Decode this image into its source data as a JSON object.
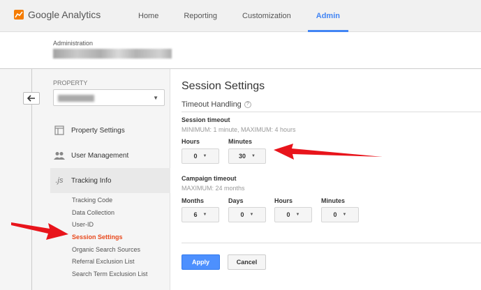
{
  "header": {
    "logo_text": "Google Analytics",
    "nav": [
      {
        "label": "Home"
      },
      {
        "label": "Reporting"
      },
      {
        "label": "Customization"
      },
      {
        "label": "Admin"
      }
    ],
    "active_nav": "Admin",
    "accent_color": "#4285f4"
  },
  "admin_bar": {
    "label": "Administration"
  },
  "left_panel": {
    "back_icon": "back-arrow-icon",
    "property_label": "PROPERTY",
    "menu": [
      {
        "label": "Property Settings",
        "icon": "property-settings-icon"
      },
      {
        "label": "User Management",
        "icon": "users-icon"
      },
      {
        "label": "Tracking Info",
        "icon": "js-icon"
      }
    ],
    "submenu": [
      {
        "label": "Tracking Code"
      },
      {
        "label": "Data Collection"
      },
      {
        "label": "User-ID"
      },
      {
        "label": "Session Settings"
      },
      {
        "label": "Organic Search Sources"
      },
      {
        "label": "Referral Exclusion List"
      },
      {
        "label": "Search Term Exclusion List"
      }
    ],
    "active_submenu": "Session Settings",
    "active_color": "#e8491d"
  },
  "main": {
    "title": "Session Settings",
    "section": "Timeout Handling",
    "help_icon": "question-icon",
    "session_timeout": {
      "label": "Session timeout",
      "hint": "MINIMUM: 1 minute, MAXIMUM: 4 hours",
      "hours_label": "Hours",
      "hours_value": "0",
      "minutes_label": "Minutes",
      "minutes_value": "30"
    },
    "campaign_timeout": {
      "label": "Campaign timeout",
      "hint": "MAXIMUM: 24 months",
      "months_label": "Months",
      "months_value": "6",
      "days_label": "Days",
      "days_value": "0",
      "hours_label": "Hours",
      "hours_value": "0",
      "minutes_label": "Minutes",
      "minutes_value": "0"
    },
    "apply_label": "Apply",
    "cancel_label": "Cancel"
  },
  "annotation_color": "#e8141b"
}
